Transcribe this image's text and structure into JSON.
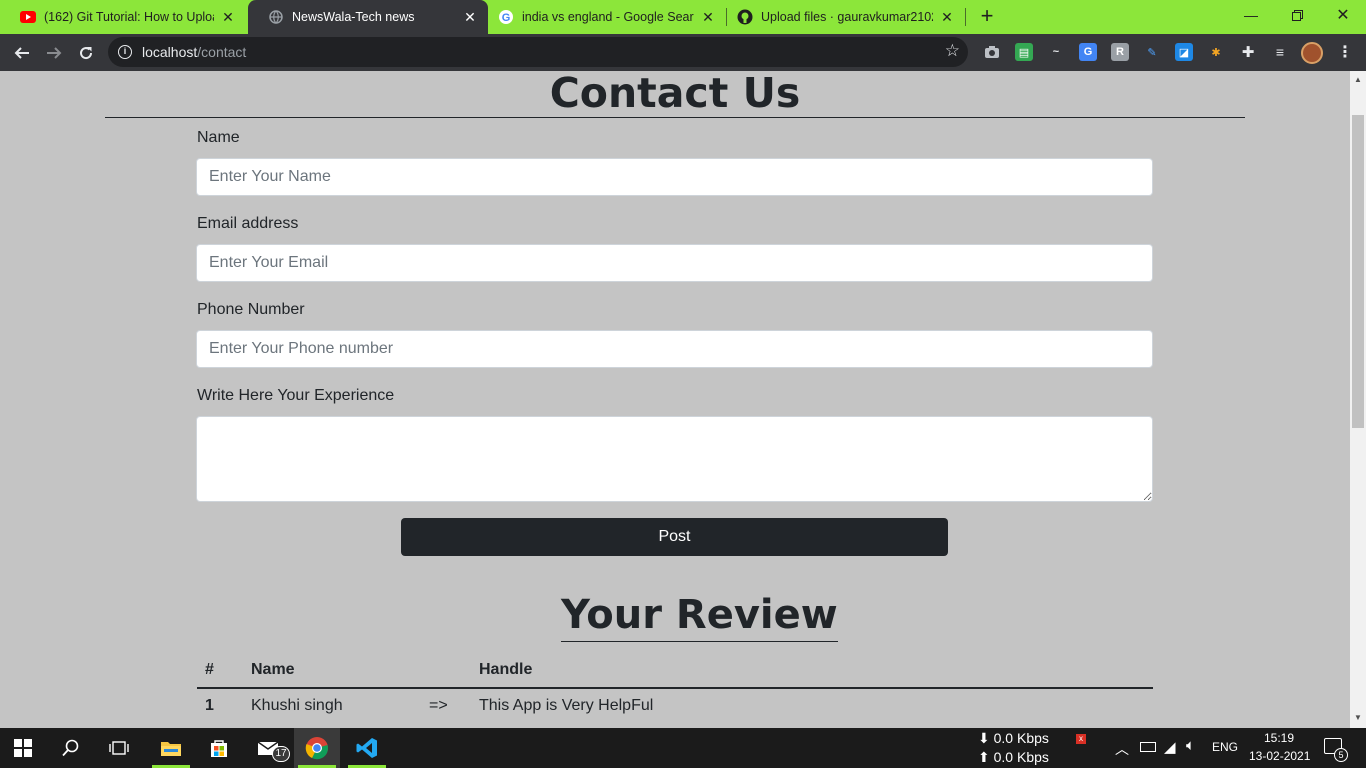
{
  "browser": {
    "tabs": [
      {
        "title": "(162) Git Tutorial: How to Upload",
        "icon": "youtube-icon",
        "active": false
      },
      {
        "title": "NewsWala-Tech news",
        "icon": "globe-icon",
        "active": true
      },
      {
        "title": "india vs england - Google Search",
        "icon": "google-icon",
        "active": false
      },
      {
        "title": "Upload files · gauravkumar2102/",
        "icon": "github-icon",
        "active": false
      }
    ],
    "url_host": "localhost",
    "url_path": "/contact"
  },
  "page": {
    "title": "Contact Us",
    "form": {
      "name_label": "Name",
      "name_placeholder": "Enter Your Name",
      "email_label": "Email address",
      "email_placeholder": "Enter Your Email",
      "phone_label": "Phone Number",
      "phone_placeholder": "Enter Your Phone number",
      "experience_label": "Write Here Your Experience",
      "experience_value": "",
      "submit_label": "Post"
    },
    "review": {
      "title": "Your Review",
      "headers": [
        "#",
        "Name",
        "Handle"
      ],
      "rows": [
        {
          "num": "1",
          "name": "Khushi singh",
          "arrow": "=>",
          "handle": "This App is Very HelpFul"
        }
      ]
    }
  },
  "taskbar": {
    "net_down": "0.0 Kbps",
    "net_up": "0.0 Kbps",
    "mail_badge": "17",
    "language": "ENG",
    "time": "15:19",
    "date": "13-02-2021",
    "notifications": "5"
  },
  "colors": {
    "tabstrip": "#8ce63a",
    "toolbar": "#35363a",
    "page_bg": "#c4c4c4",
    "button": "#212529"
  }
}
